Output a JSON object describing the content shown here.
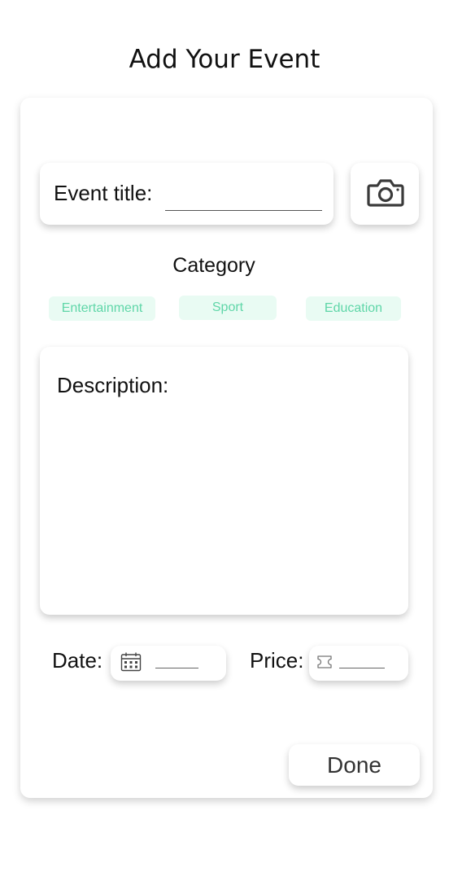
{
  "header": {
    "title": "Add Your Event"
  },
  "form": {
    "event_title_label": "Event title:",
    "event_title_value": "",
    "category_label": "Category",
    "categories": [
      "Entertainment",
      "Sport",
      "Education"
    ],
    "description_label": "Description:",
    "description_value": "",
    "date_label": "Date:",
    "date_value": "",
    "price_label": "Price:",
    "price_value": "",
    "done_label": "Done"
  },
  "colors": {
    "chip_background": "#e9fbf3",
    "chip_text": "#5fd6a8",
    "text": "#111111"
  },
  "icons": {
    "camera": "camera-icon",
    "date": "calendar-icon",
    "price": "ticket-icon"
  }
}
